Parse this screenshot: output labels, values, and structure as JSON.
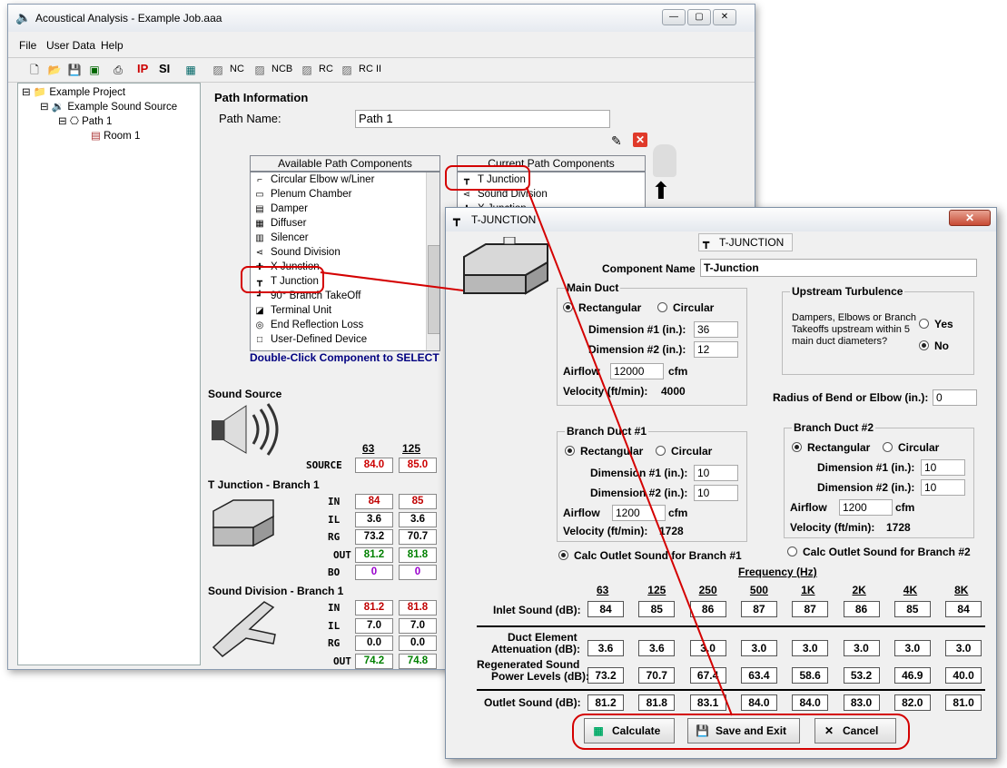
{
  "main_window": {
    "title": "Acoustical Analysis - Example Job.aaa",
    "menu": [
      "File",
      "User Data",
      "Help"
    ],
    "toolbar_labels": {
      "ip": "IP",
      "si": "SI",
      "nc": "NC",
      "ncb": "NCB",
      "rc": "RC",
      "rc2": "RC II"
    },
    "tree": {
      "project": "Example Project",
      "source": "Example Sound Source",
      "path": "Path 1",
      "room": "Room 1"
    },
    "path_info": {
      "heading": "Path Information",
      "name_label": "Path Name:",
      "name_value": "Path 1",
      "available_header": "Available Path Components",
      "current_header": "Current Path Components",
      "available": [
        {
          "label": "Circular Elbow w/Liner",
          "icon": "elbow-liner-icon",
          "glyph": "⌐"
        },
        {
          "label": "Plenum Chamber",
          "icon": "plenum-icon",
          "glyph": "▭"
        },
        {
          "label": "Damper",
          "icon": "damper-icon",
          "glyph": "▤"
        },
        {
          "label": "Diffuser",
          "icon": "diffuser-icon",
          "glyph": "▦"
        },
        {
          "label": "Silencer",
          "icon": "silencer-icon",
          "glyph": "▥"
        },
        {
          "label": "Sound Division",
          "icon": "sound-division-icon",
          "glyph": "⋖"
        },
        {
          "label": "X Junction",
          "icon": "x-junction-icon",
          "glyph": "✚"
        },
        {
          "label": "T Junction",
          "icon": "t-junction-icon",
          "glyph": "┳"
        },
        {
          "label": "90° Branch TakeOff",
          "icon": "branch-takeoff-icon",
          "glyph": "┛"
        },
        {
          "label": "Terminal Unit",
          "icon": "terminal-unit-icon",
          "glyph": "◪"
        },
        {
          "label": "End Reflection Loss",
          "icon": "end-reflection-icon",
          "glyph": "◎"
        },
        {
          "label": "User-Defined Device",
          "icon": "user-device-icon",
          "glyph": "□"
        }
      ],
      "current": [
        {
          "label": "T Junction",
          "icon": "t-junction-icon",
          "glyph": "┳"
        },
        {
          "label": "Sound Division",
          "icon": "sound-division-icon",
          "glyph": "⋖"
        },
        {
          "label": "X Junction",
          "icon": "x-junction-icon",
          "glyph": "✚"
        }
      ],
      "hint": "Double-Click Component to SELECT"
    },
    "sound_source": {
      "heading": "Sound Source",
      "freqs": [
        "63",
        "125"
      ],
      "source_label": "SOURCE",
      "source_values": [
        "84.0",
        "85.0"
      ]
    },
    "t_branch": {
      "heading": "T Junction - Branch 1",
      "rows": [
        {
          "label": "IN",
          "values": [
            "84",
            "85"
          ],
          "color": "#c00000"
        },
        {
          "label": "IL",
          "values": [
            "3.6",
            "3.6"
          ],
          "color": "#000000"
        },
        {
          "label": "RG",
          "values": [
            "73.2",
            "70.7"
          ],
          "color": "#000000"
        },
        {
          "label": "OUT",
          "values": [
            "81.2",
            "81.8"
          ],
          "color": "#008000"
        },
        {
          "label": "BO",
          "values": [
            "0",
            "0"
          ],
          "color": "#9900cc"
        }
      ]
    },
    "sd_branch": {
      "heading": "Sound Division - Branch 1",
      "rows": [
        {
          "label": "IN",
          "values": [
            "81.2",
            "81.8"
          ],
          "color": "#c00000"
        },
        {
          "label": "IL",
          "values": [
            "7.0",
            "7.0"
          ],
          "color": "#000000"
        },
        {
          "label": "RG",
          "values": [
            "0.0",
            "0.0"
          ],
          "color": "#000000"
        },
        {
          "label": "OUT",
          "values": [
            "74.2",
            "74.8"
          ],
          "color": "#008000"
        }
      ]
    }
  },
  "dialog": {
    "title": "T-JUNCTION",
    "tab": "T-JUNCTION",
    "component_name_label": "Component Name",
    "component_name_value": "T-Junction",
    "main_duct": {
      "title": "Main Duct",
      "rect": "Rectangular",
      "circ": "Circular",
      "dim1_label": "Dimension #1 (in.):",
      "dim1": "36",
      "dim2_label": "Dimension #2 (in.):",
      "dim2": "12",
      "airflow_label": "Airflow",
      "airflow": "12000",
      "cfm": "cfm",
      "velocity_label": "Velocity (ft/min):",
      "velocity": "4000"
    },
    "upstream": {
      "title": "Upstream Turbulence",
      "text": "Dampers, Elbows or Branch Takeoffs upstream within 5 main duct diameters?",
      "yes": "Yes",
      "no": "No"
    },
    "radius_label": "Radius of Bend or Elbow (in.):",
    "radius_value": "0",
    "branch1": {
      "title": "Branch Duct #1",
      "rect": "Rectangular",
      "circ": "Circular",
      "dim1_label": "Dimension #1 (in.):",
      "dim1": "10",
      "dim2_label": "Dimension #2 (in.):",
      "dim2": "10",
      "airflow_label": "Airflow",
      "airflow": "1200",
      "cfm": "cfm",
      "velocity_label": "Velocity (ft/min):",
      "velocity": "1728",
      "calc_label": "Calc Outlet Sound for Branch #1"
    },
    "branch2": {
      "title": "Branch Duct #2",
      "rect": "Rectangular",
      "circ": "Circular",
      "dim1_label": "Dimension #1 (in.):",
      "dim1": "10",
      "dim2_label": "Dimension #2 (in.):",
      "dim2": "10",
      "airflow_label": "Airflow",
      "airflow": "1200",
      "cfm": "cfm",
      "velocity_label": "Velocity (ft/min):",
      "velocity": "1728",
      "calc_label": "Calc Outlet Sound for Branch #2"
    },
    "frequency_label": "Frequency (Hz)",
    "freqs": [
      "63",
      "125",
      "250",
      "500",
      "1K",
      "2K",
      "4K",
      "8K"
    ],
    "inlet_label": "Inlet Sound (dB):",
    "inlet": [
      "84",
      "85",
      "86",
      "87",
      "87",
      "86",
      "85",
      "84"
    ],
    "atten_label_1": "Duct Element",
    "atten_label_2": "Attenuation (dB):",
    "atten": [
      "3.6",
      "3.6",
      "3.0",
      "3.0",
      "3.0",
      "3.0",
      "3.0",
      "3.0"
    ],
    "regen_label_1": "Regenerated Sound",
    "regen_label_2": "Power Levels (dB):",
    "regen": [
      "73.2",
      "70.7",
      "67.4",
      "63.4",
      "58.6",
      "53.2",
      "46.9",
      "40.0"
    ],
    "outlet_label": "Outlet Sound (dB):",
    "outlet": [
      "81.2",
      "81.8",
      "83.1",
      "84.0",
      "84.0",
      "83.0",
      "82.0",
      "81.0"
    ],
    "buttons": {
      "calculate": "Calculate",
      "save": "Save and Exit",
      "cancel": "Cancel"
    }
  },
  "colors": {
    "highlight": "#d40000",
    "hint": "#000080"
  }
}
